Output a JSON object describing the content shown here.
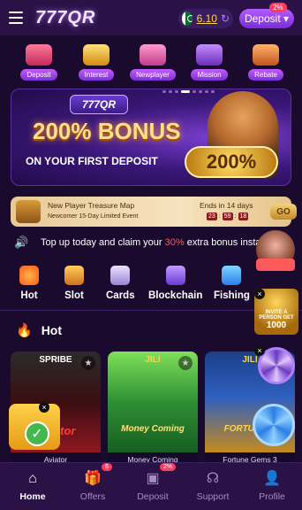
{
  "header": {
    "logo": "777QR",
    "balance": "6.10",
    "deposit_label": "Deposit ▾",
    "deposit_badge": "2%"
  },
  "quick_links": [
    {
      "label": "Deposit",
      "icon": "gift-box-icon"
    },
    {
      "label": "Interest",
      "icon": "coin-pile-icon"
    },
    {
      "label": "Newplayer",
      "icon": "gift-box-icon"
    },
    {
      "label": "Mission",
      "icon": "treasure-chest-icon"
    },
    {
      "label": "Rebate",
      "icon": "money-bag-icon"
    }
  ],
  "banner": {
    "logo_text": "777QR",
    "bonus_text": "200% BONUS",
    "subtitle": "ON YOUR FIRST DEPOSIT",
    "coin_text": "200%"
  },
  "treasure_map": {
    "title": "New Player Treasure Map",
    "subtitle": "Newcomer 15-Day Limited Event",
    "ends_text": "Ends in 14 days",
    "timer": [
      "23",
      "59",
      "18"
    ],
    "go_label": "GO"
  },
  "marquee": {
    "prefix": "Top up today and claim your ",
    "percent": "30%",
    "suffix": " extra bonus instan"
  },
  "categories": [
    {
      "label": "Hot",
      "icon": "fire-icon"
    },
    {
      "label": "Slot",
      "icon": "slot-machine-icon"
    },
    {
      "label": "Cards",
      "icon": "cards-icon"
    },
    {
      "label": "Blockchain",
      "icon": "blockchain-icon"
    },
    {
      "label": "Fishing",
      "icon": "fish-icon"
    }
  ],
  "hot_section": {
    "title": "Hot"
  },
  "games": [
    {
      "title": "Aviator",
      "brand": "SPRIBE",
      "name": "Aviator"
    },
    {
      "title": "Money Coming",
      "brand": "JILI",
      "name": "Money Coming"
    },
    {
      "title": "Fortune Gems 3",
      "brand": "JILI",
      "name": "FORTUNE G"
    }
  ],
  "floating": {
    "invite_text": "INVITE A PERSON GET",
    "invite_amount": "1000"
  },
  "bottom_nav": [
    {
      "label": "Home",
      "icon": "home-icon",
      "active": true
    },
    {
      "label": "Offers",
      "icon": "gift-icon",
      "badge": "6"
    },
    {
      "label": "Deposit",
      "icon": "wallet-icon",
      "badge": "2%"
    },
    {
      "label": "Support",
      "icon": "headset-icon"
    },
    {
      "label": "Profile",
      "icon": "user-icon"
    }
  ],
  "colors": {
    "background": "#1a0b2e",
    "header": "#2a1247",
    "accent": "#b35cff",
    "balance": "#ffd34d",
    "badge": "#ff3b5c"
  }
}
